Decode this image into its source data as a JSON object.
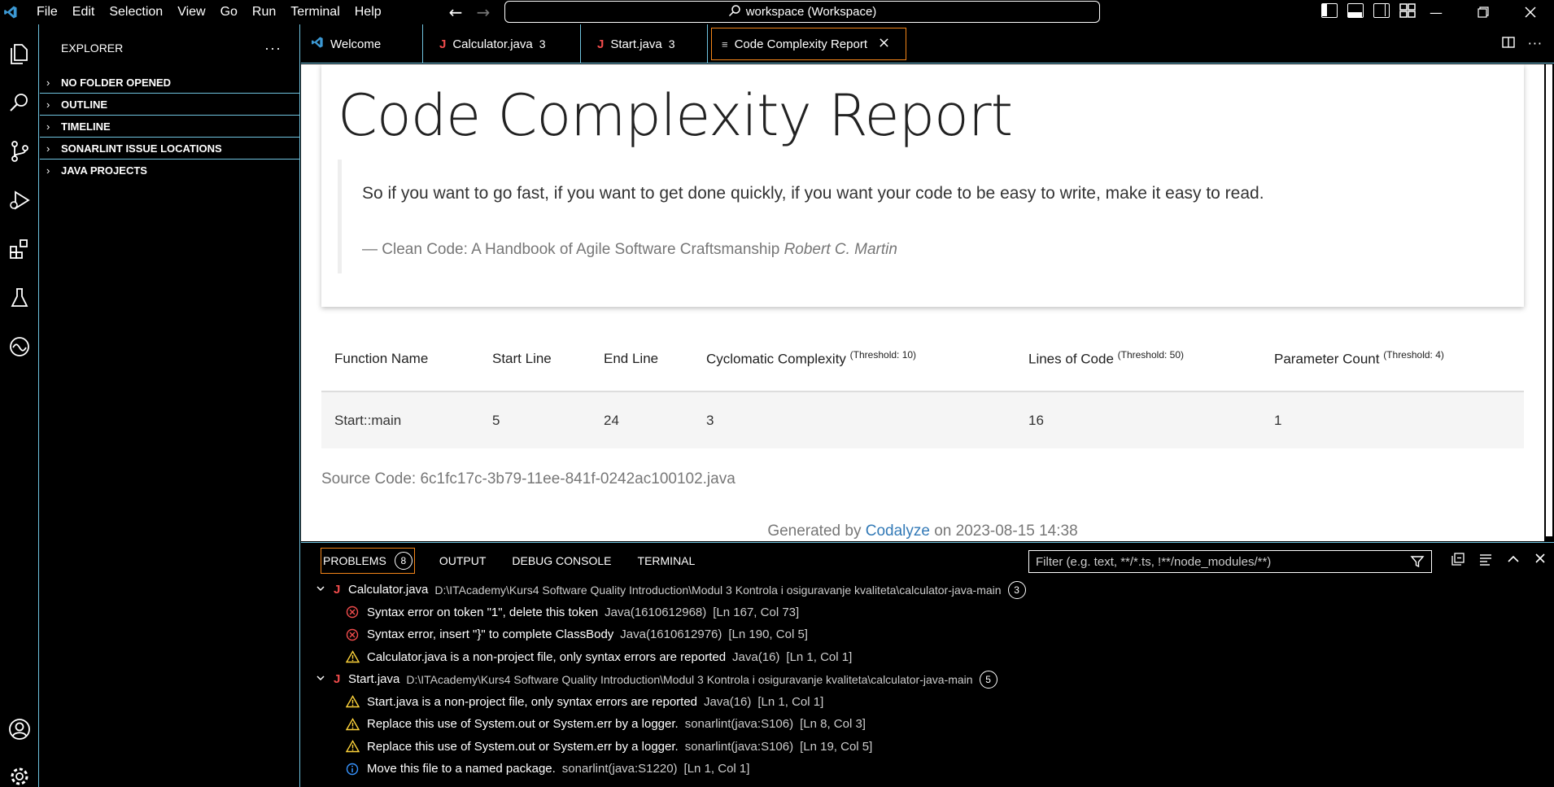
{
  "titlebar": {
    "menu": [
      "File",
      "Edit",
      "Selection",
      "View",
      "Go",
      "Run",
      "Terminal",
      "Help"
    ],
    "search": "workspace (Workspace)"
  },
  "sidebar": {
    "title": "EXPLORER",
    "sections": [
      "NO FOLDER OPENED",
      "OUTLINE",
      "TIMELINE",
      "SONARLINT ISSUE LOCATIONS",
      "JAVA PROJECTS"
    ]
  },
  "tabs": [
    {
      "label": "Welcome",
      "badge": ""
    },
    {
      "label": "Calculator.java",
      "badge": "3"
    },
    {
      "label": "Start.java",
      "badge": "3"
    },
    {
      "label": "Code Complexity Report",
      "badge": ""
    }
  ],
  "report": {
    "title": "Code Complexity Report",
    "quote": "So if you want to go fast, if you want to get done quickly, if you want your code to be easy to write, make it easy to read.",
    "quote_source": "— Clean Code: A Handbook of Agile Software Craftsmanship",
    "quote_author": "Robert C. Martin",
    "columns": [
      {
        "label": "Function Name",
        "threshold": ""
      },
      {
        "label": "Start Line",
        "threshold": ""
      },
      {
        "label": "End Line",
        "threshold": ""
      },
      {
        "label": "Cyclomatic Complexity",
        "threshold": "(Threshold: 10)"
      },
      {
        "label": "Lines of Code",
        "threshold": "(Threshold: 50)"
      },
      {
        "label": "Parameter Count",
        "threshold": "(Threshold: 4)"
      }
    ],
    "rows": [
      [
        "Start::main",
        "5",
        "24",
        "3",
        "16",
        "1"
      ]
    ],
    "source": "Source Code: 6c1fc17c-3b79-11ee-841f-0242ac100102.java",
    "generated_prefix": "Generated by",
    "generated_link": "Codalyze",
    "generated_suffix": "on 2023-08-15 14:38"
  },
  "panel": {
    "tabs": [
      "PROBLEMS",
      "OUTPUT",
      "DEBUG CONSOLE",
      "TERMINAL"
    ],
    "problem_count": "8",
    "filter_placeholder": "Filter (e.g. text, **/*.ts, !**/node_modules/**)",
    "files": [
      {
        "name": "Calculator.java",
        "path": "D:\\ITAcademy\\Kurs4 Software Quality Introduction\\Modul 3 Kontrola i osiguravanje kvaliteta\\calculator-java-main",
        "count": "3",
        "problems": [
          {
            "severity": "error",
            "message": "Syntax error on token \"1\", delete this token",
            "source": "Java(1610612968)",
            "location": "[Ln 167, Col 73]"
          },
          {
            "severity": "error",
            "message": "Syntax error, insert \"}\" to complete ClassBody",
            "source": "Java(1610612976)",
            "location": "[Ln 190, Col 5]"
          },
          {
            "severity": "warning",
            "message": "Calculator.java is a non-project file, only syntax errors are reported",
            "source": "Java(16)",
            "location": "[Ln 1, Col 1]"
          }
        ]
      },
      {
        "name": "Start.java",
        "path": "D:\\ITAcademy\\Kurs4 Software Quality Introduction\\Modul 3 Kontrola i osiguravanje kvaliteta\\calculator-java-main",
        "count": "5",
        "problems": [
          {
            "severity": "warning",
            "message": "Start.java is a non-project file, only syntax errors are reported",
            "source": "Java(16)",
            "location": "[Ln 1, Col 1]"
          },
          {
            "severity": "warning",
            "message": "Replace this use of System.out or System.err by a logger.",
            "source": "sonarlint(java:S106)",
            "location": "[Ln 8, Col 3]"
          },
          {
            "severity": "warning",
            "message": "Replace this use of System.out or System.err by a logger.",
            "source": "sonarlint(java:S106)",
            "location": "[Ln 19, Col 5]"
          },
          {
            "severity": "info",
            "message": "Move this file to a named package.",
            "source": "sonarlint(java:S1220)",
            "location": "[Ln 1, Col 1]"
          }
        ]
      }
    ]
  },
  "colors": {
    "accent_border": "#6fc3df",
    "active_border": "#f38518",
    "error": "#f14c4c",
    "warning": "#ffd43b",
    "info": "#3794ff",
    "link": "#337ab7"
  }
}
